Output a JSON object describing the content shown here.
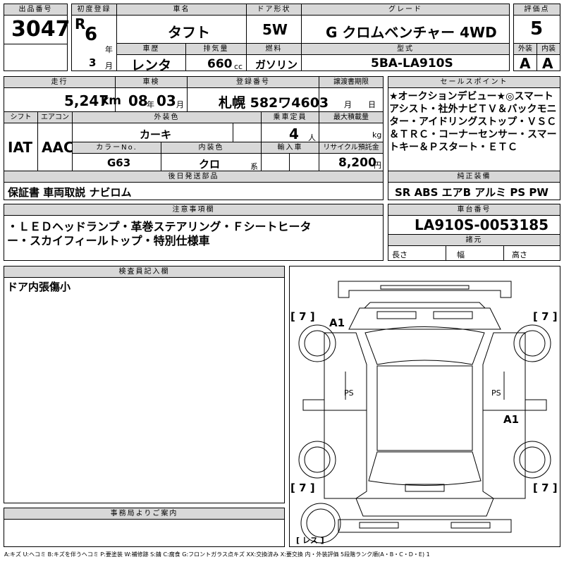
{
  "labels": {
    "lot_no": "出品番号",
    "first_reg": "初度登録",
    "car_name": "車名",
    "door": "ドア形状",
    "grade": "グレード",
    "score": "評価点",
    "history": "車歴",
    "displacement": "排気量",
    "fuel": "燃料",
    "model": "型式",
    "exterior": "外装",
    "interior": "内装",
    "mileage": "走行",
    "inspection": "車検",
    "reg_no": "登録番号",
    "transfer": "譲渡書期限",
    "sales_point": "セールスポイント",
    "shift": "シフト",
    "aircon": "エアコン",
    "ext_color": "外装色",
    "capacity": "乗車定員",
    "max_load": "最大積載量",
    "color_no": "カラーNo.",
    "int_color": "内装色",
    "import": "輸入車",
    "recycle": "リサイクル預託金",
    "later_parts": "後日発送部品",
    "equipment": "純正装備",
    "notes": "注意事項欄",
    "chassis": "車台番号",
    "dimensions": "諸元",
    "inspector": "検査員記入欄",
    "office": "事務局よりご案内"
  },
  "units": {
    "year": "年",
    "month": "月",
    "cc": "cc",
    "km": "km",
    "people": "人",
    "kg": "kg",
    "yen": "円",
    "system": "系",
    "length": "長さ",
    "width": "幅",
    "height": "高さ"
  },
  "values": {
    "lot_no": "3047",
    "era": "R",
    "reg_year": "6",
    "reg_month": "3",
    "car_name": "タフト",
    "door": "5W",
    "grade": "G クロムベンチャー 4WD",
    "score": "5",
    "history": "レンタ",
    "displacement": "660",
    "fuel": "ガソリン",
    "model": "5BA-LA910S",
    "exterior": "A",
    "interior": "A",
    "mileage": "5,247",
    "insp_year": "08",
    "insp_month": "03",
    "reg_no": "札幌 582ワ4603",
    "sales_point": "★オークションデビュー★◎スマートアシスト・社外ナビＴＶ＆バックモニター・アイドリングストップ・ＶＳＣ＆ＴＲＣ・コーナーセンサー・スマートキー＆Ｐスタート・ＥＴＣ",
    "shift": "IAT",
    "aircon": "AAC",
    "ext_color": "カーキ",
    "capacity": "4",
    "color_no": "G63",
    "int_color": "クロ",
    "recycle": "8,200",
    "later_parts": "保証書 車両取説 ナビロム",
    "equipment": "SR ABS エアB アルミ PS PW",
    "notes_line1": "・ＬＥＤヘッドランプ・革巻ステアリング・Ｆシートヒータ",
    "notes_line2": "ー・スカイフィールトップ・特別仕様車",
    "chassis": "LA910S-0053185",
    "inspector_note": "ドア内張傷小"
  },
  "diagram": {
    "tire_fl": "[ 7 ]",
    "tire_fr": "[ 7 ]",
    "tire_rl": "[ 7 ]",
    "tire_rr": "[ 7 ]",
    "spare": "[ レス ]",
    "mark_front_left": "A1",
    "mark_rear_right": "A1",
    "ps_left": "PS",
    "ps_right": "PS"
  },
  "legend": "A:キズ U:ヘコミ B:キズを伴うヘコミ P:要塗装 W:補修跡 S:錆 C:腐食 G:フロントガラス点キズ XX:交換済み X:要交換 内・外装評価 5段階ランク順(A・B・C・D・E) 1"
}
